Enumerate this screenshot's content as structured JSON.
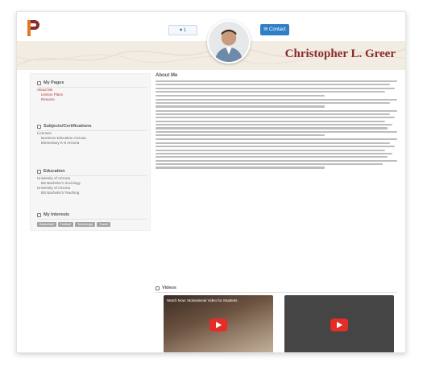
{
  "header": {
    "like_label": "♥ 1",
    "contact_label": "✉ Contact",
    "teacher_name": "Christopher L. Greer"
  },
  "sidebar": {
    "my_pages": {
      "title": "My Pages",
      "items": [
        "About Me",
        "Lesson Plans",
        "Resume"
      ]
    },
    "subjects": {
      "title": "Subjects/Certifications",
      "lines": [
        "Licenses",
        "Business Education  Arizona",
        "Elementary K-8  Arizona"
      ]
    },
    "education": {
      "title": "Education",
      "lines": [
        "University of Arizona",
        "BS Bachelor's  Sociology",
        "University of Arizona",
        "BS Bachelor's  Teaching"
      ]
    },
    "interests": {
      "title": "My Interests",
      "tags": [
        "Basketball",
        "Football",
        "Technology",
        "Travel"
      ]
    }
  },
  "about": {
    "title": "About Me"
  },
  "videos": {
    "title": "Videos",
    "items": [
      {
        "title": "Watch Now: Motivational Video for Students"
      },
      {
        "title": ""
      }
    ]
  },
  "colors": {
    "accent_name": "#8b2b2b",
    "contact_button": "#2f7fc7",
    "logo_orange": "#e07a1f",
    "play_red": "#e52d27"
  }
}
